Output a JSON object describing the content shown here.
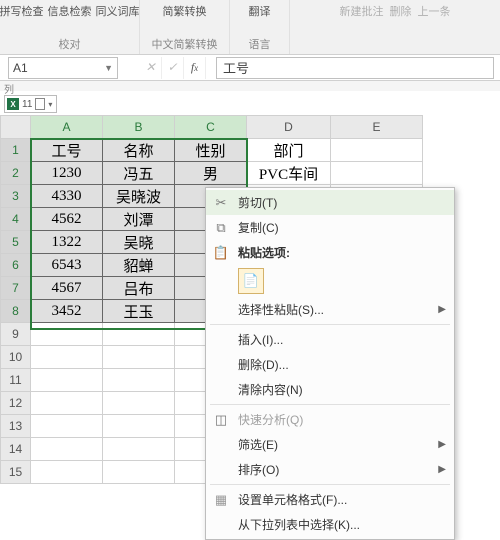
{
  "ribbon": {
    "group1": {
      "btn1": "拼写检查",
      "btn2": "信息检索",
      "btn3": "同义词库",
      "label": "校对"
    },
    "group2": {
      "btn1": "简繁转换",
      "btn2": "中文简繁转换",
      "label": "中文简繁转换"
    },
    "group3": {
      "btn1": "翻译",
      "label": "语言"
    },
    "group4": {
      "btn1": "新建批注",
      "btn2": "删除",
      "btn3": "上一条"
    }
  },
  "namebox": "A1",
  "formula": "工号",
  "book_strip": "列",
  "booktab": "11",
  "columns": [
    "A",
    "B",
    "C",
    "D",
    "E"
  ],
  "rows": [
    "1",
    "2",
    "3",
    "4",
    "5",
    "6",
    "7",
    "8",
    "9",
    "10",
    "11",
    "12",
    "13",
    "14",
    "15"
  ],
  "chart_data": {
    "type": "table",
    "headers": [
      "工号",
      "名称",
      "性别",
      "部门"
    ],
    "rows": [
      [
        "1230",
        "冯五",
        "男",
        "PVC车间"
      ],
      [
        "4330",
        "吴晓波",
        "",
        ""
      ],
      [
        "4562",
        "刘潭",
        "",
        ""
      ],
      [
        "1322",
        "吴晓",
        "",
        ""
      ],
      [
        "6543",
        "貂蝉",
        "",
        ""
      ],
      [
        "4567",
        "吕布",
        "",
        ""
      ],
      [
        "3452",
        "王玉",
        "",
        ""
      ]
    ]
  },
  "context_menu": {
    "cut": "剪切(T)",
    "copy": "复制(C)",
    "paste_options": "粘贴选项:",
    "paste_special": "选择性粘贴(S)...",
    "insert": "插入(I)...",
    "delete": "删除(D)...",
    "clear": "清除内容(N)",
    "quick": "快速分析(Q)",
    "filter": "筛选(E)",
    "sort": "排序(O)",
    "format": "设置单元格格式(F)...",
    "dropdown": "从下拉列表中选择(K)..."
  }
}
